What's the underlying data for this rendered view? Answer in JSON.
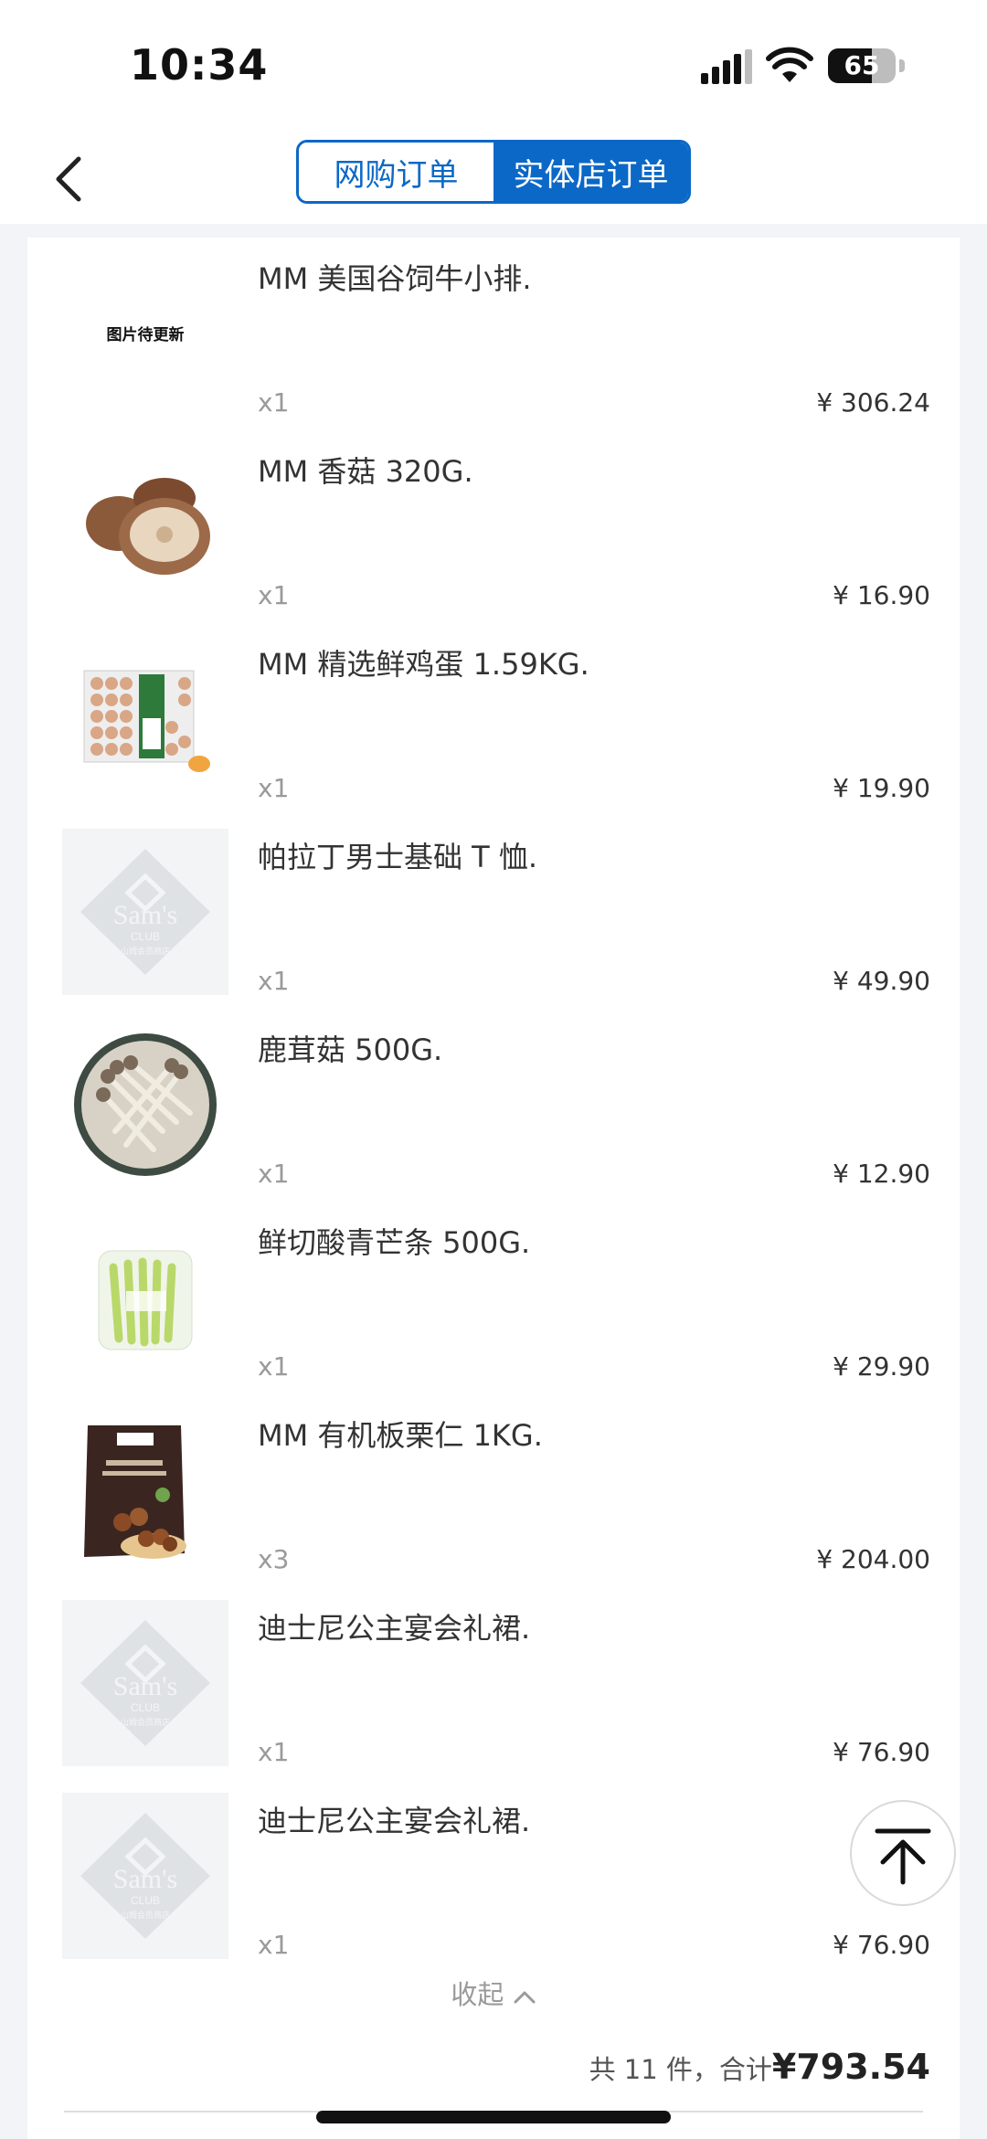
{
  "status": {
    "time": "10:34",
    "battery": "65",
    "battery_level": 0.65
  },
  "tabs": {
    "online": "网购订单",
    "store": "实体店订单"
  },
  "items": [
    {
      "name": "MM 美国谷饲牛小排.",
      "qty": "x1",
      "price": "¥ 306.24",
      "image": "placeholder-text",
      "placeholder": "图片待更新"
    },
    {
      "name": "MM 香菇 320G.",
      "qty": "x1",
      "price": "¥ 16.90",
      "image": "mushroom"
    },
    {
      "name": "MM 精选鲜鸡蛋 1.59KG.",
      "qty": "x1",
      "price": "¥ 19.90",
      "image": "eggs"
    },
    {
      "name": "帕拉丁男士基础 T 恤.",
      "qty": "x1",
      "price": "¥ 49.90",
      "image": "sams-logo"
    },
    {
      "name": "鹿茸菇 500G.",
      "qty": "x1",
      "price": "¥ 12.90",
      "image": "enoki-bowl"
    },
    {
      "name": "鲜切酸青芒条 500G.",
      "qty": "x1",
      "price": "¥ 29.90",
      "image": "mango-strips"
    },
    {
      "name": "MM 有机板栗仁 1KG.",
      "qty": "x3",
      "price": "¥ 204.00",
      "image": "chestnut-bag"
    },
    {
      "name": "迪士尼公主宴会礼裙.",
      "qty": "x1",
      "price": "¥ 76.90",
      "image": "sams-logo"
    },
    {
      "name": "迪士尼公主宴会礼裙.",
      "qty": "x1",
      "price": "¥ 76.90",
      "image": "sams-logo"
    }
  ],
  "collapse_label": "收起",
  "summary": {
    "count_text": "共 11 件，合计",
    "total": "¥793.54"
  },
  "logo_text": {
    "brand": "Sam's",
    "sub": "CLUB",
    "cn": "山姆会员商店"
  }
}
